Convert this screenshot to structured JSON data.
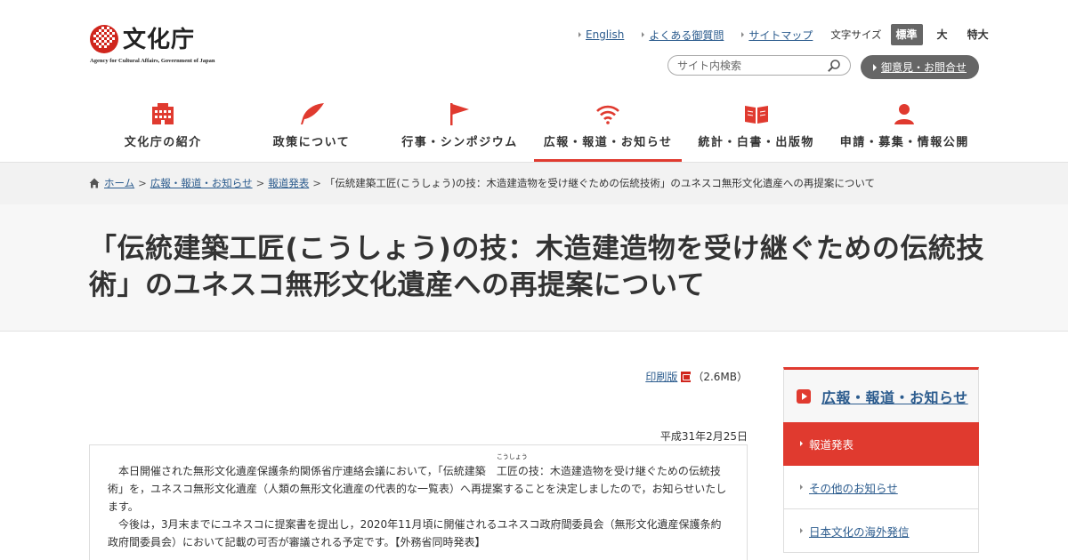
{
  "header": {
    "logo_text": "文化庁",
    "logo_sub": "Agency for Cultural Affairs, Government of Japan",
    "util_links": [
      "English",
      "よくある御質問",
      "サイトマップ"
    ],
    "font_size_label": "文字サイズ",
    "font_sizes": [
      "標準",
      "大",
      "特大"
    ],
    "search_placeholder": "サイト内検索",
    "contact_label": "御意見・お問合せ"
  },
  "nav": {
    "items": [
      {
        "label": "文化庁の紹介",
        "icon": "building-icon"
      },
      {
        "label": "政策について",
        "icon": "feather-icon"
      },
      {
        "label": "行事・シンポジウム",
        "icon": "flag-icon"
      },
      {
        "label": "広報・報道・お知らせ",
        "icon": "wifi-icon"
      },
      {
        "label": "統計・白書・出版物",
        "icon": "book-icon"
      },
      {
        "label": "申請・募集・情報公開",
        "icon": "person-icon"
      }
    ]
  },
  "breadcrumb": {
    "home": "ホーム",
    "level1": "広報・報道・お知らせ",
    "level2": "報道発表",
    "sep": ">",
    "current": "「伝統建築工匠(こうしょう)の技：木造建造物を受け継ぐための伝統技術」のユネスコ無形文化遺産への再提案について"
  },
  "page": {
    "title": "「伝統建築工匠(こうしょう)の技：木造建造物を受け継ぐための伝統技術」のユネスコ無形文化遺産への再提案について",
    "print_label": "印刷版",
    "print_size": "（2.6MB）",
    "date": "平成31年2月25日",
    "notice": {
      "p1_before": "本日開催された無形文化遺産保護条約関係省庁連絡会議において，「伝統建築",
      "p1_ruby_base": "工匠",
      "p1_ruby_text": "こうしょう",
      "p1_after": "の技：木造建造物を受け継ぐための伝統技術」を，ユネスコ無形文化遺産（人類の無形文化遺産の代表的な一覧表）へ再提案することを決定しましたので，お知らせいたします。",
      "p2": "今後は，3月末までにユネスコに提案書を提出し，2020年11月頃に開催されるユネスコ政府間委員会（無形文化遺産保護条約政府間委員会）において記載の可否が審議される予定です。【外務省同時発表】"
    }
  },
  "sidebar": {
    "heading": "広報・報道・お知らせ",
    "items": [
      "報道発表",
      "その他のお知らせ",
      "日本文化の海外発信"
    ]
  },
  "colors": {
    "accent": "#e03a2f",
    "link": "#2c5c8e"
  }
}
